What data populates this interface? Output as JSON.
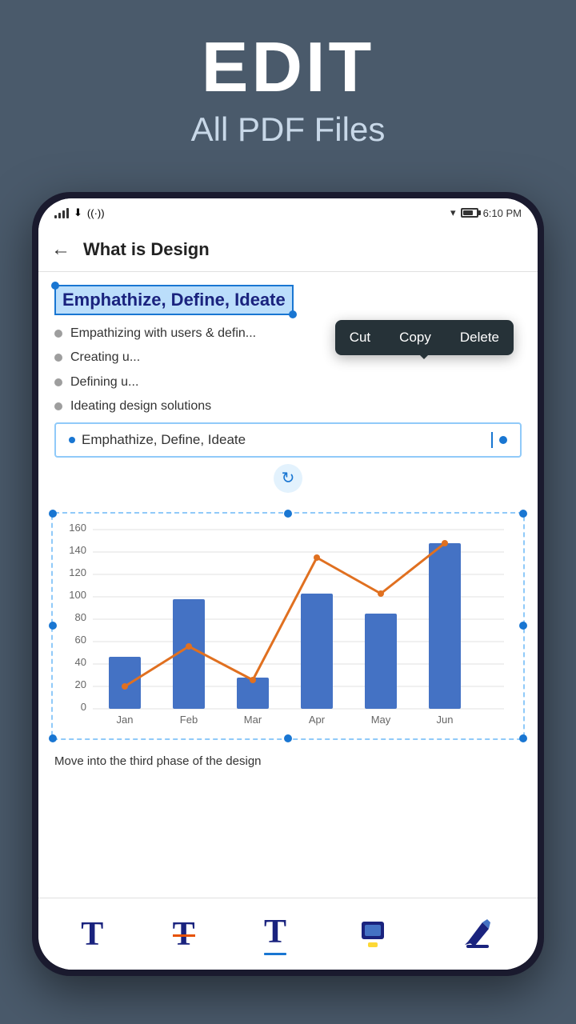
{
  "header": {
    "title": "EDIT",
    "subtitle": "All PDF Files"
  },
  "status_bar": {
    "time": "6:10 PM",
    "battery_label": "Battery"
  },
  "toolbar": {
    "back_label": "←",
    "title": "What is Design"
  },
  "content": {
    "selected_text": "Emphathize, Define, Ideate",
    "context_menu": {
      "cut": "Cut",
      "copy": "Copy",
      "delete": "Delete"
    },
    "bullet_items": [
      "Empathizing with users & defin...",
      "Creating u...",
      "Defining u...",
      "Ideating design solutions"
    ],
    "edit_box_text": "Emphathize, Define, Ideate",
    "body_text": "Move into the third phase of the design",
    "chart": {
      "y_labels": [
        "0",
        "20",
        "40",
        "60",
        "80",
        "100",
        "120",
        "140",
        "160"
      ],
      "x_labels": [
        "Jan",
        "Feb",
        "Mar",
        "Apr",
        "May",
        "Jun"
      ],
      "bars": [
        46,
        98,
        28,
        103,
        85,
        148
      ],
      "line": [
        20,
        56,
        26,
        135,
        103,
        148
      ]
    }
  },
  "bottom_toolbar": {
    "tools": [
      {
        "id": "text-normal",
        "label": "T",
        "type": "text"
      },
      {
        "id": "text-strikethrough",
        "label": "T",
        "type": "strikethrough"
      },
      {
        "id": "text-underline",
        "label": "T",
        "type": "underline"
      },
      {
        "id": "highlight",
        "label": "highlight"
      },
      {
        "id": "pen",
        "label": "pen"
      }
    ]
  }
}
